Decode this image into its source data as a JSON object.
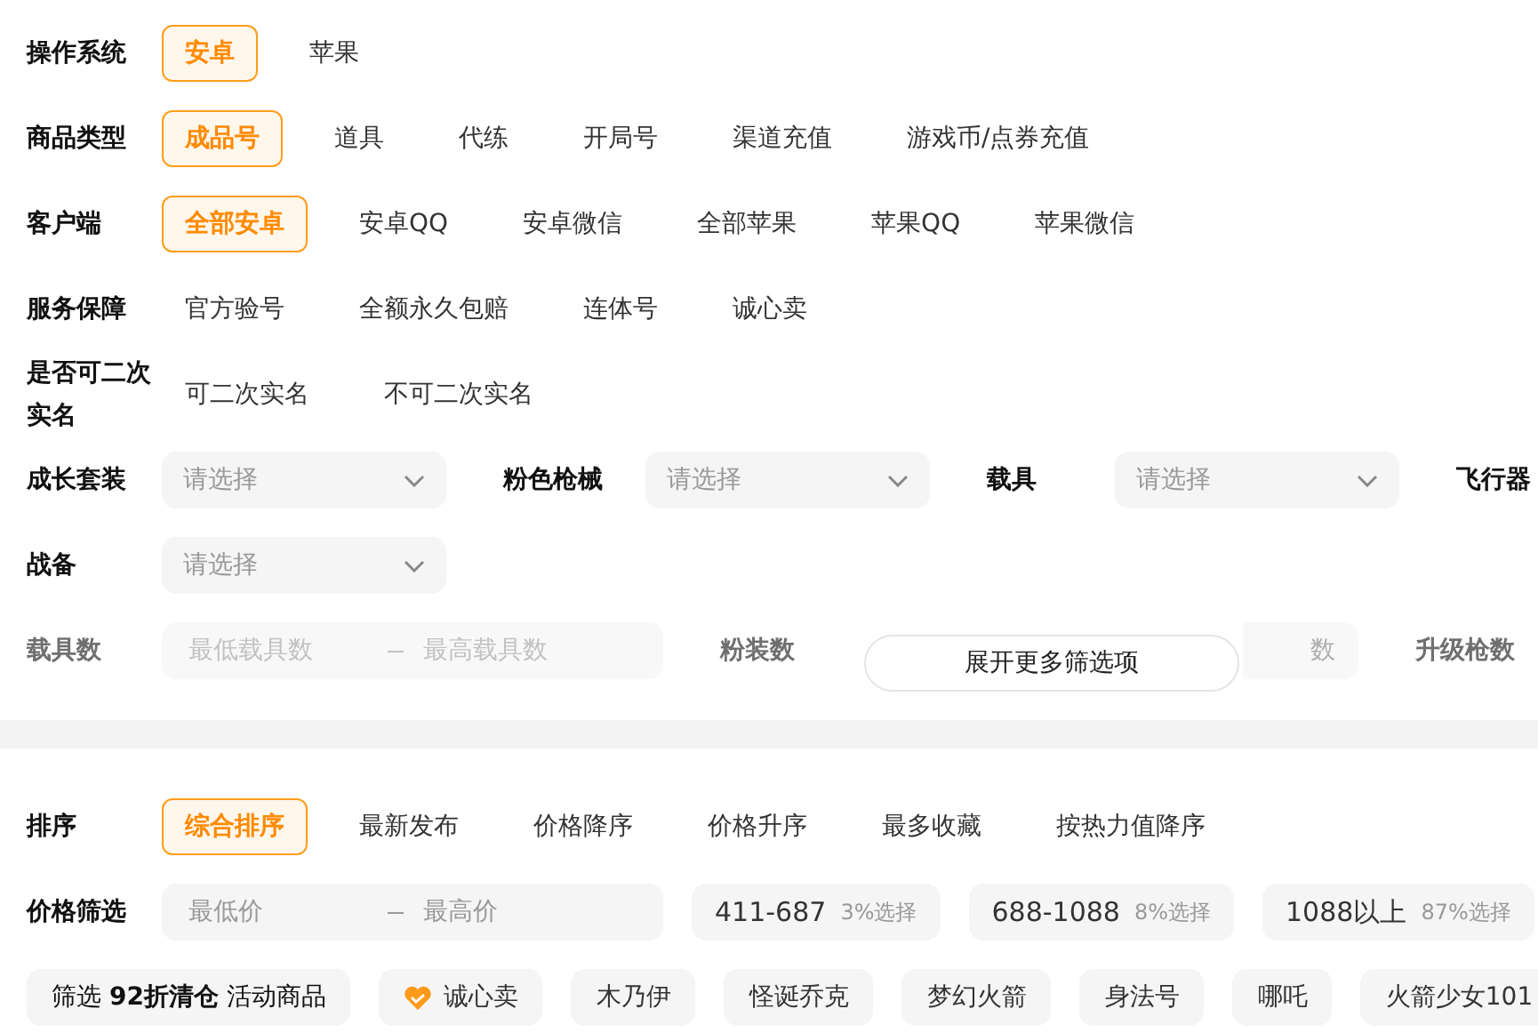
{
  "filters": [
    {
      "label": "操作系统",
      "kind": "options",
      "options": [
        {
          "label": "安卓",
          "selected": true
        },
        {
          "label": "苹果",
          "selected": false
        }
      ]
    },
    {
      "label": "商品类型",
      "kind": "options",
      "options": [
        {
          "label": "成品号",
          "selected": true
        },
        {
          "label": "道具",
          "selected": false
        },
        {
          "label": "代练",
          "selected": false
        },
        {
          "label": "开局号",
          "selected": false
        },
        {
          "label": "渠道充值",
          "selected": false
        },
        {
          "label": "游戏币/点券充值",
          "selected": false
        }
      ]
    },
    {
      "label": "客户端",
      "kind": "options",
      "options": [
        {
          "label": "全部安卓",
          "selected": true
        },
        {
          "label": "安卓QQ",
          "selected": false
        },
        {
          "label": "安卓微信",
          "selected": false
        },
        {
          "label": "全部苹果",
          "selected": false
        },
        {
          "label": "苹果QQ",
          "selected": false
        },
        {
          "label": "苹果微信",
          "selected": false
        }
      ]
    },
    {
      "label": "服务保障",
      "kind": "options",
      "options": [
        {
          "label": "官方验号",
          "selected": false
        },
        {
          "label": "全额永久包赔",
          "selected": false
        },
        {
          "label": "连体号",
          "selected": false
        },
        {
          "label": "诚心卖",
          "selected": false
        }
      ]
    },
    {
      "label": "是否可二次实名",
      "kind": "options",
      "options": [
        {
          "label": "可二次实名",
          "selected": false
        },
        {
          "label": "不可二次实名",
          "selected": false
        }
      ]
    },
    {
      "label": "成长套装",
      "kind": "selects",
      "selects": [
        {
          "placeholder": "请选择"
        },
        {
          "label": "粉色枪械",
          "placeholder": "请选择"
        },
        {
          "label": "载具",
          "placeholder": "请选择"
        },
        {
          "label": "飞行器"
        }
      ]
    },
    {
      "label": "战备",
      "kind": "selects",
      "selects": [
        {
          "placeholder": "请选择"
        }
      ]
    },
    {
      "label": "载具数",
      "kind": "ranges",
      "faded": true,
      "ranges": [
        {
          "min_placeholder": "最低载具数",
          "max_placeholder": "最高载具数"
        },
        {
          "label": "粉装数",
          "tail": "数"
        },
        {
          "label": "升级枪数"
        }
      ]
    }
  ],
  "expand_button": "展开更多筛选项",
  "sort": {
    "label": "排序",
    "options": [
      {
        "label": "综合排序",
        "selected": true
      },
      {
        "label": "最新发布",
        "selected": false
      },
      {
        "label": "价格降序",
        "selected": false
      },
      {
        "label": "价格升序",
        "selected": false
      },
      {
        "label": "最多收藏",
        "selected": false
      },
      {
        "label": "按热力值降序",
        "selected": false
      }
    ]
  },
  "price": {
    "label": "价格筛选",
    "min_placeholder": "最低价",
    "max_placeholder": "最高价",
    "presets": [
      {
        "range": "411-687",
        "share": "3%选择"
      },
      {
        "range": "688-1088",
        "share": "8%选择"
      },
      {
        "range": "1088以上",
        "share": "87%选择"
      }
    ]
  },
  "tags": [
    {
      "kind": "promo",
      "label": "筛选 **92折清仓** 活动商品"
    },
    {
      "kind": "heart",
      "label": "诚心卖"
    },
    {
      "kind": "plain",
      "label": "木乃伊"
    },
    {
      "kind": "plain",
      "label": "怪诞乔克"
    },
    {
      "kind": "plain",
      "label": "梦幻火箭"
    },
    {
      "kind": "plain",
      "label": "身法号"
    },
    {
      "kind": "plain",
      "label": "哪吒"
    },
    {
      "kind": "plain",
      "label": "火箭少女101"
    }
  ]
}
